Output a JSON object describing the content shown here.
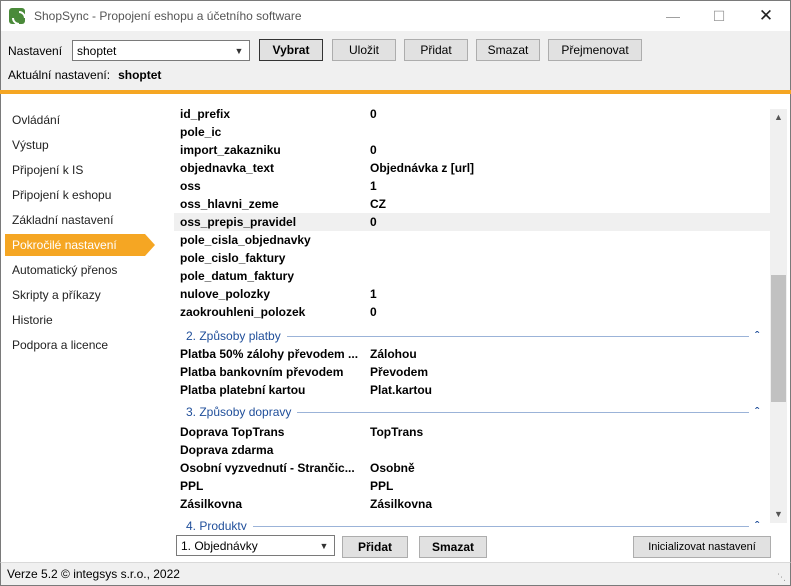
{
  "window": {
    "title": "ShopSync - Propojení eshopu a účetního software",
    "icon": "shopsync-logo-icon"
  },
  "toolbar": {
    "nastaveni_label": "Nastavení",
    "config_selected": "shoptet",
    "vybrat": "Vybrat",
    "ulozit": "Uložit",
    "pridat": "Přidat",
    "smazat": "Smazat",
    "prejmenovat": "Přejmenovat",
    "current_label": "Aktuální nastavení:",
    "current_value": "shoptet"
  },
  "sidebar": {
    "items": [
      {
        "label": "Ovládání"
      },
      {
        "label": "Výstup"
      },
      {
        "label": "Připojení k IS"
      },
      {
        "label": "Připojení k eshopu"
      },
      {
        "label": "Základní nastavení"
      },
      {
        "label": "Pokročilé nastavení",
        "active": true
      },
      {
        "label": "Automatický přenos"
      },
      {
        "label": "Skripty a příkazy"
      },
      {
        "label": "Historie"
      },
      {
        "label": "Podpora a licence"
      }
    ]
  },
  "content": {
    "rows_top": [
      {
        "key": "id_prefix",
        "value": "0"
      },
      {
        "key": "pole_ic",
        "value": ""
      },
      {
        "key": "import_zakazniku",
        "value": "0"
      },
      {
        "key": "objednavka_text",
        "value": "Objednávka z [url]"
      },
      {
        "key": "oss",
        "value": "1"
      },
      {
        "key": "oss_hlavni_zeme",
        "value": "CZ"
      },
      {
        "key": "oss_prepis_pravidel",
        "value": "0"
      },
      {
        "key": "pole_cisla_objednavky",
        "value": ""
      },
      {
        "key": "pole_cislo_faktury",
        "value": ""
      },
      {
        "key": "pole_datum_faktury",
        "value": ""
      },
      {
        "key": "nulove_polozky",
        "value": "1"
      },
      {
        "key": "zaokrouhleni_polozek",
        "value": "0"
      }
    ],
    "section2": {
      "title": "2. Způsoby platby",
      "rows": [
        {
          "key": "Platba 50% zálohy převodem ...",
          "value": "Zálohou"
        },
        {
          "key": "Platba bankovním převodem",
          "value": "Převodem"
        },
        {
          "key": "Platba platební kartou",
          "value": "Plat.kartou"
        }
      ]
    },
    "section3": {
      "title": "3. Způsoby dopravy",
      "rows": [
        {
          "key": "Doprava TopTrans",
          "value": "TopTrans"
        },
        {
          "key": "Doprava zdarma",
          "value": ""
        },
        {
          "key": "Osobní vyzvednutí - Strančic...",
          "value": "Osobně"
        },
        {
          "key": "PPL",
          "value": "PPL"
        },
        {
          "key": "Zásilkovna",
          "value": "Zásilkovna"
        }
      ]
    },
    "section4_partial": "4. Produkty"
  },
  "bottom": {
    "combo_selected": "1. Objednávky",
    "pridat": "Přidat",
    "smazat": "Smazat",
    "init": "Inicializovat nastavení"
  },
  "status": {
    "text": "Verze 5.2  © integsys s.r.o., 2022"
  }
}
